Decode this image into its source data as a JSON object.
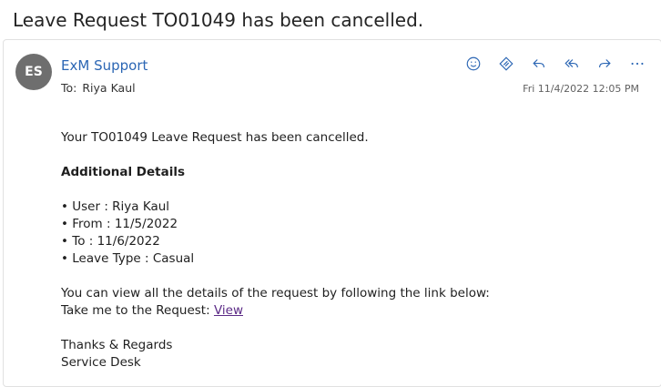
{
  "subject": "Leave Request TO01049 has been cancelled.",
  "sender": {
    "initials": "ES",
    "name": "ExM Support"
  },
  "to": {
    "label": "To:",
    "name": "Riya Kaul"
  },
  "date": "Fri 11/4/2022 12:05 PM",
  "actions": [
    {
      "name": "emoji-icon"
    },
    {
      "name": "immersive-reader-icon"
    },
    {
      "name": "reply-icon"
    },
    {
      "name": "reply-all-icon"
    },
    {
      "name": "forward-icon"
    },
    {
      "name": "more-icon"
    }
  ],
  "body": {
    "intro": "Your TO01049 Leave Request has been cancelled.",
    "details_heading": "Additional Details",
    "details": [
      "• User : Riya Kaul",
      "• From : 11/5/2022",
      "• To : 11/6/2022",
      "• Leave Type : Casual"
    ],
    "link_intro": "You can view all the details of the request by following the link below:",
    "link_prefix": "Take me to the Request:",
    "link_text": "View",
    "closing": "Thanks & Regards",
    "signature": "Service Desk"
  },
  "colors": {
    "accent": "#2b66b4",
    "link": "#5b2a86",
    "avatar": "#6e6e6e"
  }
}
